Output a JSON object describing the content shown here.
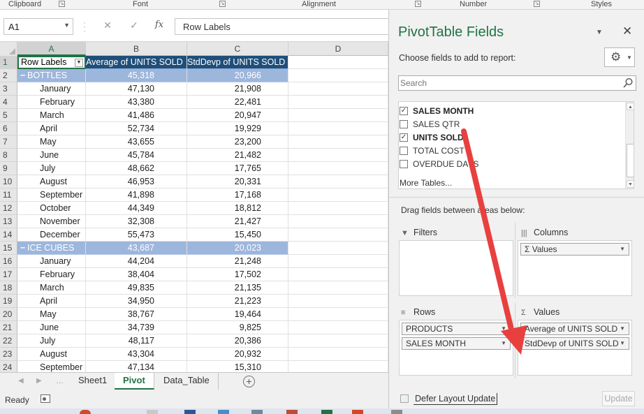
{
  "ribbon": {
    "groups": [
      "Clipboard",
      "Font",
      "Alignment",
      "Number",
      "Styles"
    ]
  },
  "formula_bar": {
    "name_box": "A1",
    "cancel_symbol": "✕",
    "enter_symbol": "✓",
    "fx_symbol": "fx",
    "content": "Row Labels"
  },
  "grid": {
    "columns": [
      "A",
      "B",
      "C",
      "D"
    ],
    "header_row": {
      "num": "1",
      "a": "Row Labels",
      "b": "Average of UNITS SOLD",
      "c": "StdDevp of UNITS SOLD"
    },
    "rows": [
      {
        "num": "2",
        "label": "BOTTLES",
        "avg": "45,318",
        "std": "20,966",
        "group": true
      },
      {
        "num": "3",
        "label": "January",
        "avg": "47,130",
        "std": "21,908",
        "group": false
      },
      {
        "num": "4",
        "label": "February",
        "avg": "43,380",
        "std": "22,481",
        "group": false
      },
      {
        "num": "5",
        "label": "March",
        "avg": "41,486",
        "std": "20,947",
        "group": false
      },
      {
        "num": "6",
        "label": "April",
        "avg": "52,734",
        "std": "19,929",
        "group": false
      },
      {
        "num": "7",
        "label": "May",
        "avg": "43,655",
        "std": "23,200",
        "group": false
      },
      {
        "num": "8",
        "label": "June",
        "avg": "45,784",
        "std": "21,482",
        "group": false
      },
      {
        "num": "9",
        "label": "July",
        "avg": "48,662",
        "std": "17,765",
        "group": false
      },
      {
        "num": "10",
        "label": "August",
        "avg": "46,953",
        "std": "20,331",
        "group": false
      },
      {
        "num": "11",
        "label": "September",
        "avg": "41,898",
        "std": "17,168",
        "group": false
      },
      {
        "num": "12",
        "label": "October",
        "avg": "44,349",
        "std": "18,812",
        "group": false
      },
      {
        "num": "13",
        "label": "November",
        "avg": "32,308",
        "std": "21,427",
        "group": false
      },
      {
        "num": "14",
        "label": "December",
        "avg": "55,473",
        "std": "15,450",
        "group": false
      },
      {
        "num": "15",
        "label": "ICE CUBES",
        "avg": "43,687",
        "std": "20,023",
        "group": true
      },
      {
        "num": "16",
        "label": "January",
        "avg": "44,204",
        "std": "21,248",
        "group": false
      },
      {
        "num": "17",
        "label": "February",
        "avg": "38,404",
        "std": "17,502",
        "group": false
      },
      {
        "num": "18",
        "label": "March",
        "avg": "49,835",
        "std": "21,135",
        "group": false
      },
      {
        "num": "19",
        "label": "April",
        "avg": "34,950",
        "std": "21,223",
        "group": false
      },
      {
        "num": "20",
        "label": "May",
        "avg": "38,767",
        "std": "19,464",
        "group": false
      },
      {
        "num": "21",
        "label": "June",
        "avg": "34,739",
        "std": "9,825",
        "group": false
      },
      {
        "num": "22",
        "label": "July",
        "avg": "48,117",
        "std": "20,386",
        "group": false
      },
      {
        "num": "23",
        "label": "August",
        "avg": "43,304",
        "std": "20,932",
        "group": false
      },
      {
        "num": "24",
        "label": "September",
        "avg": "47,134",
        "std": "15,310",
        "group": false
      }
    ]
  },
  "sheets": {
    "tabs": [
      "Sheet1",
      "Pivot",
      "Data_Table"
    ],
    "active": "Pivot"
  },
  "status": {
    "ready": "Ready"
  },
  "pivot_pane": {
    "title": "PivotTable Fields",
    "subtitle": "Choose fields to add to report:",
    "search_placeholder": "Search",
    "fields": [
      {
        "name": "SALES MONTH",
        "checked": true
      },
      {
        "name": "SALES QTR",
        "checked": false
      },
      {
        "name": "UNITS SOLD",
        "checked": true
      },
      {
        "name": "TOTAL COST",
        "checked": false
      },
      {
        "name": "OVERDUE DAYS",
        "checked": false
      }
    ],
    "more_tables": "More Tables...",
    "drag_label": "Drag fields between areas below:",
    "areas": {
      "filters": {
        "label": "Filters",
        "items": []
      },
      "columns": {
        "label": "Columns",
        "items": [
          "Σ  Values"
        ]
      },
      "rows": {
        "label": "Rows",
        "items": [
          "PRODUCTS",
          "SALES MONTH"
        ]
      },
      "values": {
        "label": "Values",
        "items": [
          "Average of UNITS SOLD",
          "StdDevp of UNITS SOLD"
        ]
      }
    },
    "defer_label": "Defer Layout Update",
    "update_label": "Update"
  },
  "colors": {
    "excel_green": "#217346",
    "header_fill": "#1f4e79",
    "group_fill": "#9db6dc",
    "arrow_red": "#e8403f"
  }
}
